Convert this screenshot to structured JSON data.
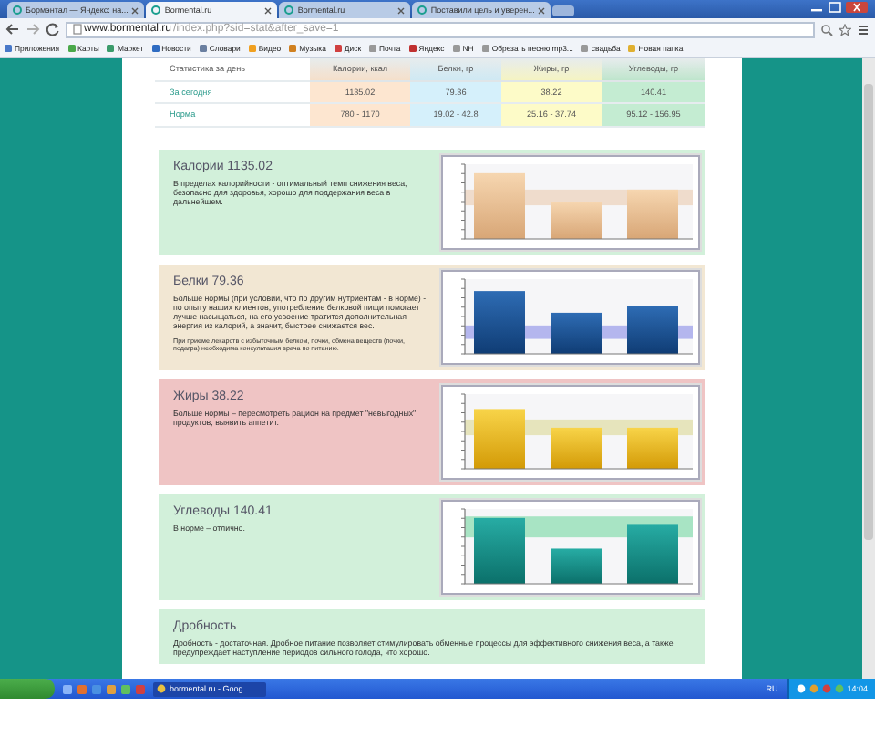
{
  "browser": {
    "tabs": [
      {
        "title": "Бормэнтал — Яндекс: на...",
        "selected": false
      },
      {
        "title": "Bormental.ru",
        "selected": true
      },
      {
        "title": "Bormental.ru",
        "selected": false
      },
      {
        "title": "Поставили цель и уверен...",
        "selected": false
      }
    ],
    "address": {
      "host": "www.bormental.ru",
      "path": "/index.php?sid=stat&after_save=1"
    },
    "bookmarks": [
      "Приложения",
      "Карты",
      "Маркет",
      "Новости",
      "Словари",
      "Видео",
      "Музыка",
      "Диск",
      "Почта",
      "Яндекс",
      "NH",
      "Обрезать песню mp3...",
      "свадьба",
      "Новая папка"
    ]
  },
  "stats_table": {
    "columns": [
      "Статистика за день",
      "Калории, ккал",
      "Белки, гр",
      "Жиры, гр",
      "Углеводы, гр"
    ],
    "rows": [
      {
        "cells": [
          "За сегодня",
          "1135.02",
          "79.36",
          "38.22",
          "140.41"
        ]
      },
      {
        "cells": [
          "Норма",
          "780 - 1170",
          "19.02 - 42.8",
          "25.16 - 37.74",
          "95.12 - 156.95"
        ]
      }
    ]
  },
  "panels": [
    {
      "kind": "calories",
      "color": "#d2f0da",
      "chart": true,
      "title": "Калории 1135.02",
      "text": "В пределах калорийности - оптимальный темп снижения веса, безопасно для здоровья, хорошо для поддержания веса в дальнейшем."
    },
    {
      "kind": "protein",
      "color": "#f2e7d3",
      "chart": true,
      "title": "Белки 79.36",
      "text": "Больше нормы (при условии, что по другим нутриентам - в норме) - по опыту наших клиентов, употребление белковой пищи помогает лучше насыщаться, на его усвоение тратится дополнительная энергия из калорий, а значит, быстрее снижается вес.",
      "note": "При приеме лекарств с избыточным белком, почки, обмена веществ (почки, подагра) необходима консультация врача по питанию."
    },
    {
      "kind": "fat",
      "color": "#efc4c4",
      "chart": true,
      "title": "Жиры 38.22",
      "text": "Больше нормы – пересмотреть рацион на предмет \"невыгодных\" продуктов, выявить аппетит."
    },
    {
      "kind": "carbs",
      "color": "#d2f0da",
      "chart": true,
      "title": "Углеводы 140.41",
      "text": "В норме – отлично."
    },
    {
      "kind": "fraction",
      "color": "#d2f0da",
      "title": "Дробность",
      "text": "Дробность - достаточная. Дробное питание позволяет стимулировать обменные процессы для эффективного снижения веса, а также предупреждает наступление периодов сильного голода, что хорошо."
    }
  ],
  "taskbar": {
    "tasks": [
      "bormental.ru - Goog..."
    ],
    "language": "RU",
    "clock": "14:04"
  }
}
